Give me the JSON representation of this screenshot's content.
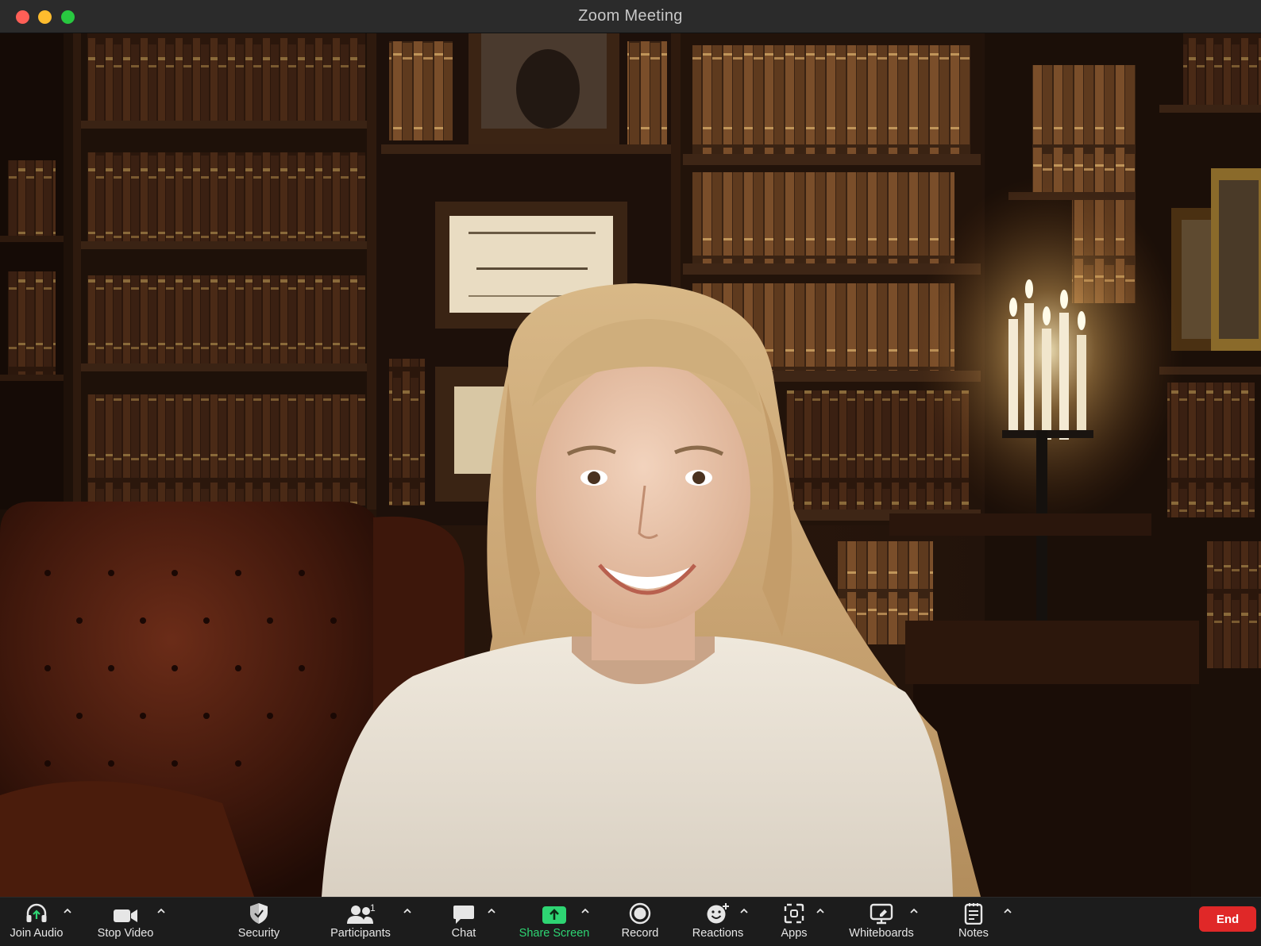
{
  "window": {
    "title": "Zoom Meeting"
  },
  "toolbar": {
    "join_audio": "Join Audio",
    "stop_video": "Stop Video",
    "security": "Security",
    "participants": "Participants",
    "participants_count": "1",
    "chat": "Chat",
    "share_screen": "Share Screen",
    "record": "Record",
    "reactions": "Reactions",
    "apps": "Apps",
    "whiteboards": "Whiteboards",
    "notes": "Notes",
    "end": "End"
  },
  "colors": {
    "share_accent": "#2ed573",
    "end_button": "#e02828",
    "toolbar_bg": "#1c1c1c",
    "titlebar_bg": "#2b2b2b"
  },
  "icons": {
    "join_audio": "headphones-icon",
    "stop_video": "video-camera-icon",
    "security": "shield-icon",
    "participants": "people-icon",
    "chat": "chat-bubble-icon",
    "share_screen": "share-arrow-icon",
    "record": "record-icon",
    "reactions": "smiley-plus-icon",
    "apps": "apps-icon",
    "whiteboards": "whiteboard-icon",
    "notes": "notes-icon"
  }
}
